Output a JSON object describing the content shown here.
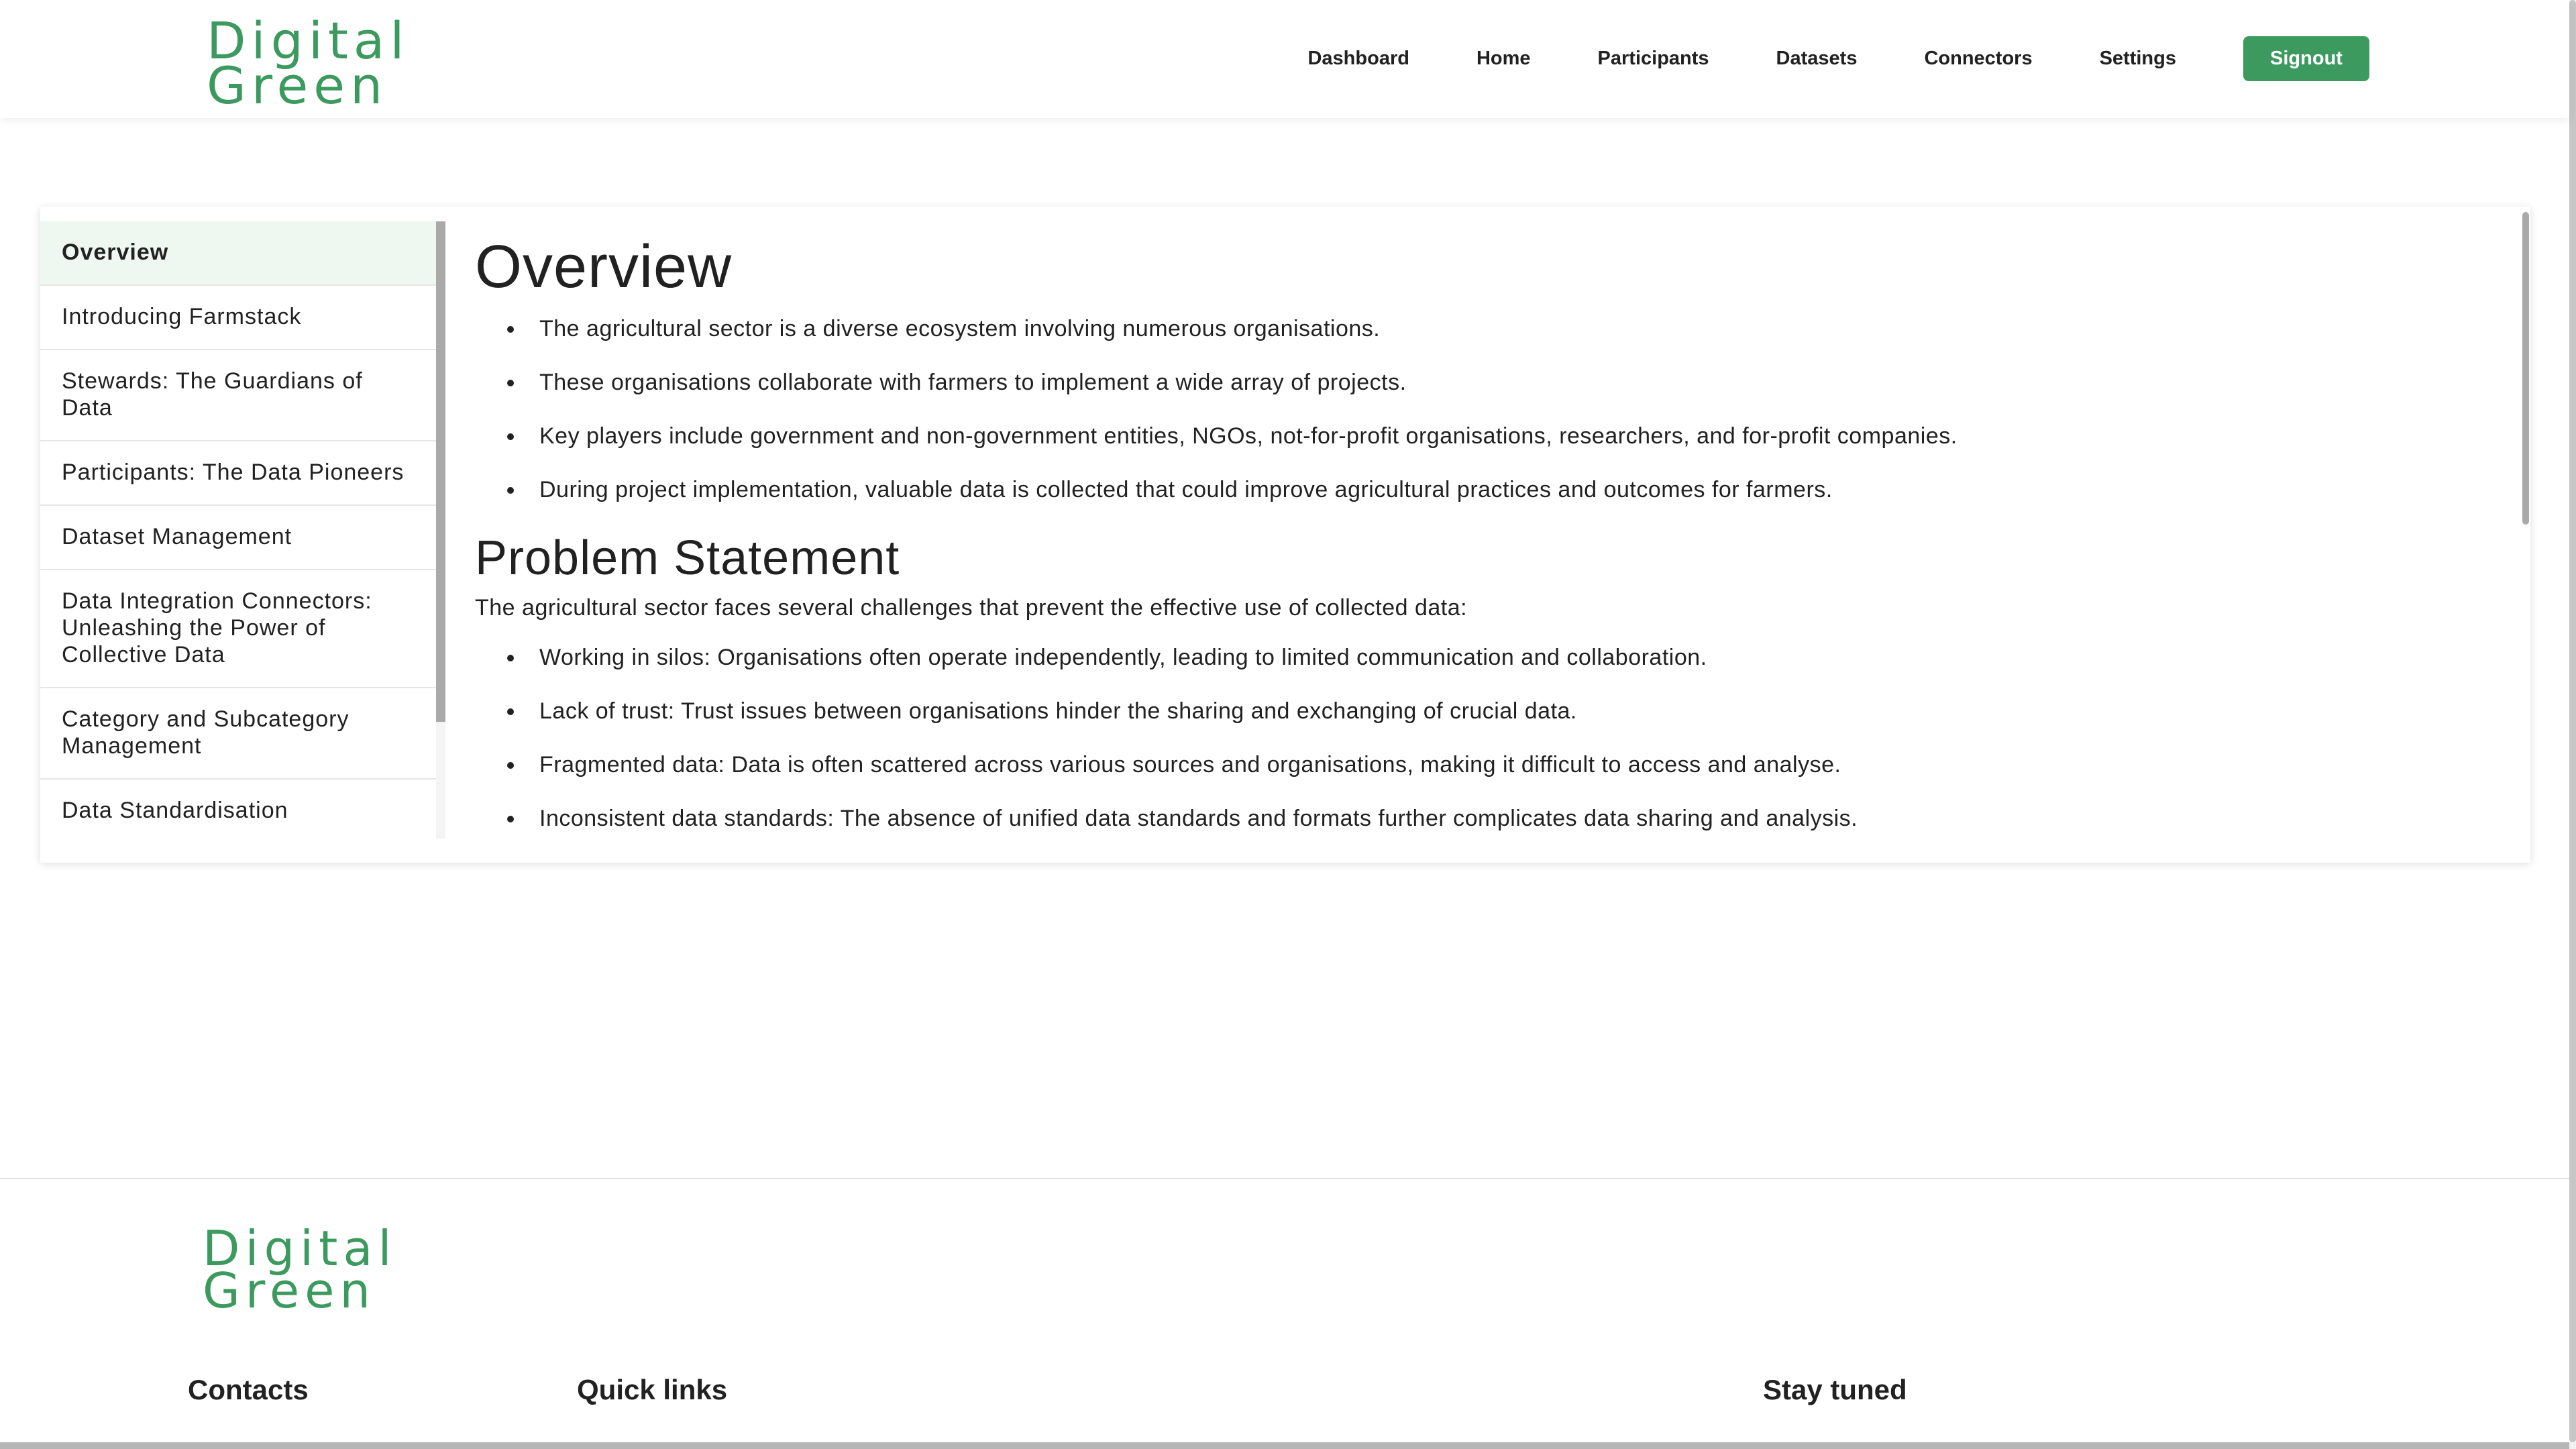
{
  "colors": {
    "brand": "#3c9a5f",
    "active_background": "#eef8f1"
  },
  "header": {
    "logo_line1": "Digital",
    "logo_line2": "Green",
    "nav": [
      "Dashboard",
      "Home",
      "Participants",
      "Datasets",
      "Connectors",
      "Settings"
    ],
    "signout_label": "Signout"
  },
  "sidebar": {
    "items": [
      "Overview",
      "Introducing Farmstack",
      "Stewards: The Guardians of Data",
      "Participants: The Data Pioneers",
      "Dataset Management",
      "Data Integration Connectors: Unleashing the Power of Collective Data",
      "Category and Subcategory Management",
      "Data Standardisation"
    ],
    "active_index": 0
  },
  "content": {
    "overview_title": "Overview",
    "overview_bullets": [
      "The agricultural sector is a diverse ecosystem involving numerous organisations.",
      "These organisations collaborate with farmers to implement a wide array of projects.",
      "Key players include government and non-government entities, NGOs, not-for-profit organisations, researchers, and for-profit companies.",
      "During project implementation, valuable data is collected that could improve agricultural practices and outcomes for farmers."
    ],
    "problem_title": "Problem Statement",
    "problem_intro": "The agricultural sector faces several challenges that prevent the effective use of collected data:",
    "problem_bullets": [
      "Working in silos: Organisations often operate independently, leading to limited communication and collaboration.",
      "Lack of trust: Trust issues between organisations hinder the sharing and exchanging of crucial data.",
      "Fragmented data: Data is often scattered across various sources and organisations, making it difficult to access and analyse.",
      "Inconsistent data standards: The absence of unified data standards and formats further complicates data sharing and analysis."
    ]
  },
  "footer": {
    "logo_line1": "Digital",
    "logo_line2": "Green",
    "contacts_heading": "Contacts",
    "quick_links_heading": "Quick links",
    "stay_tuned_heading": "Stay tuned"
  }
}
